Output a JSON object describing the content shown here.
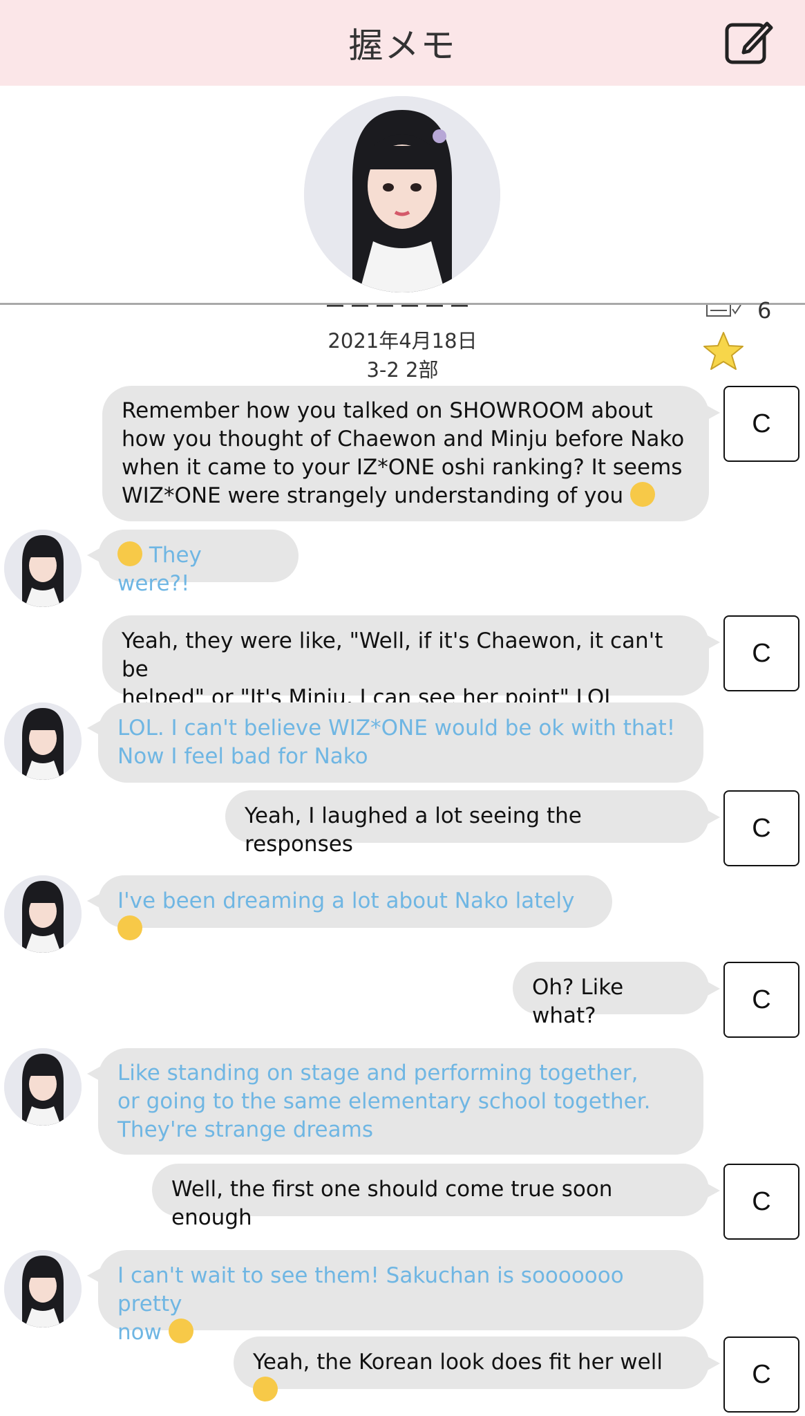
{
  "header": {
    "title": "握メモ",
    "edit_icon": "edit-icon"
  },
  "memo": {
    "ticket_count": "6",
    "date": "2021年4月18日",
    "session": "3-2 2部"
  },
  "button_label": "C",
  "messages": [
    {
      "from": "me",
      "text": "Remember how you talked on SHOWROOM about\nhow you thought of Chaewon and Minju before Nako\nwhen it came to your IZ*ONE oshi ranking? It seems\nWIZ*ONE were strangely understanding of you",
      "emoji": "😂"
    },
    {
      "from": "them",
      "prefix_emoji": "🤣",
      "text": " They were?!"
    },
    {
      "from": "me",
      "text": "Yeah, they were like, \"Well, if it's Chaewon, it can't be\nhelped\" or \"It's Minju, I can see her point\" LOL"
    },
    {
      "from": "them",
      "text": "LOL. I can't believe WIZ*ONE would be ok with that!\nNow I feel bad for Nako"
    },
    {
      "from": "me",
      "text": "Yeah, I laughed a lot seeing the responses"
    },
    {
      "from": "them",
      "text": "I've been dreaming a lot about Nako lately",
      "emoji": "🥺"
    },
    {
      "from": "me",
      "text": "Oh? Like what?"
    },
    {
      "from": "them",
      "text": "Like standing on stage and performing together,\nor going to the same elementary school together.\nThey're strange dreams"
    },
    {
      "from": "me",
      "text": "Well, the first one should come true soon enough"
    },
    {
      "from": "them",
      "text": "I can't wait to see them! Sakuchan is sooooooo pretty\nnow",
      "emoji": "😍"
    },
    {
      "from": "me",
      "text": "Yeah, the Korean look does fit her well",
      "emoji": "🥰"
    }
  ]
}
